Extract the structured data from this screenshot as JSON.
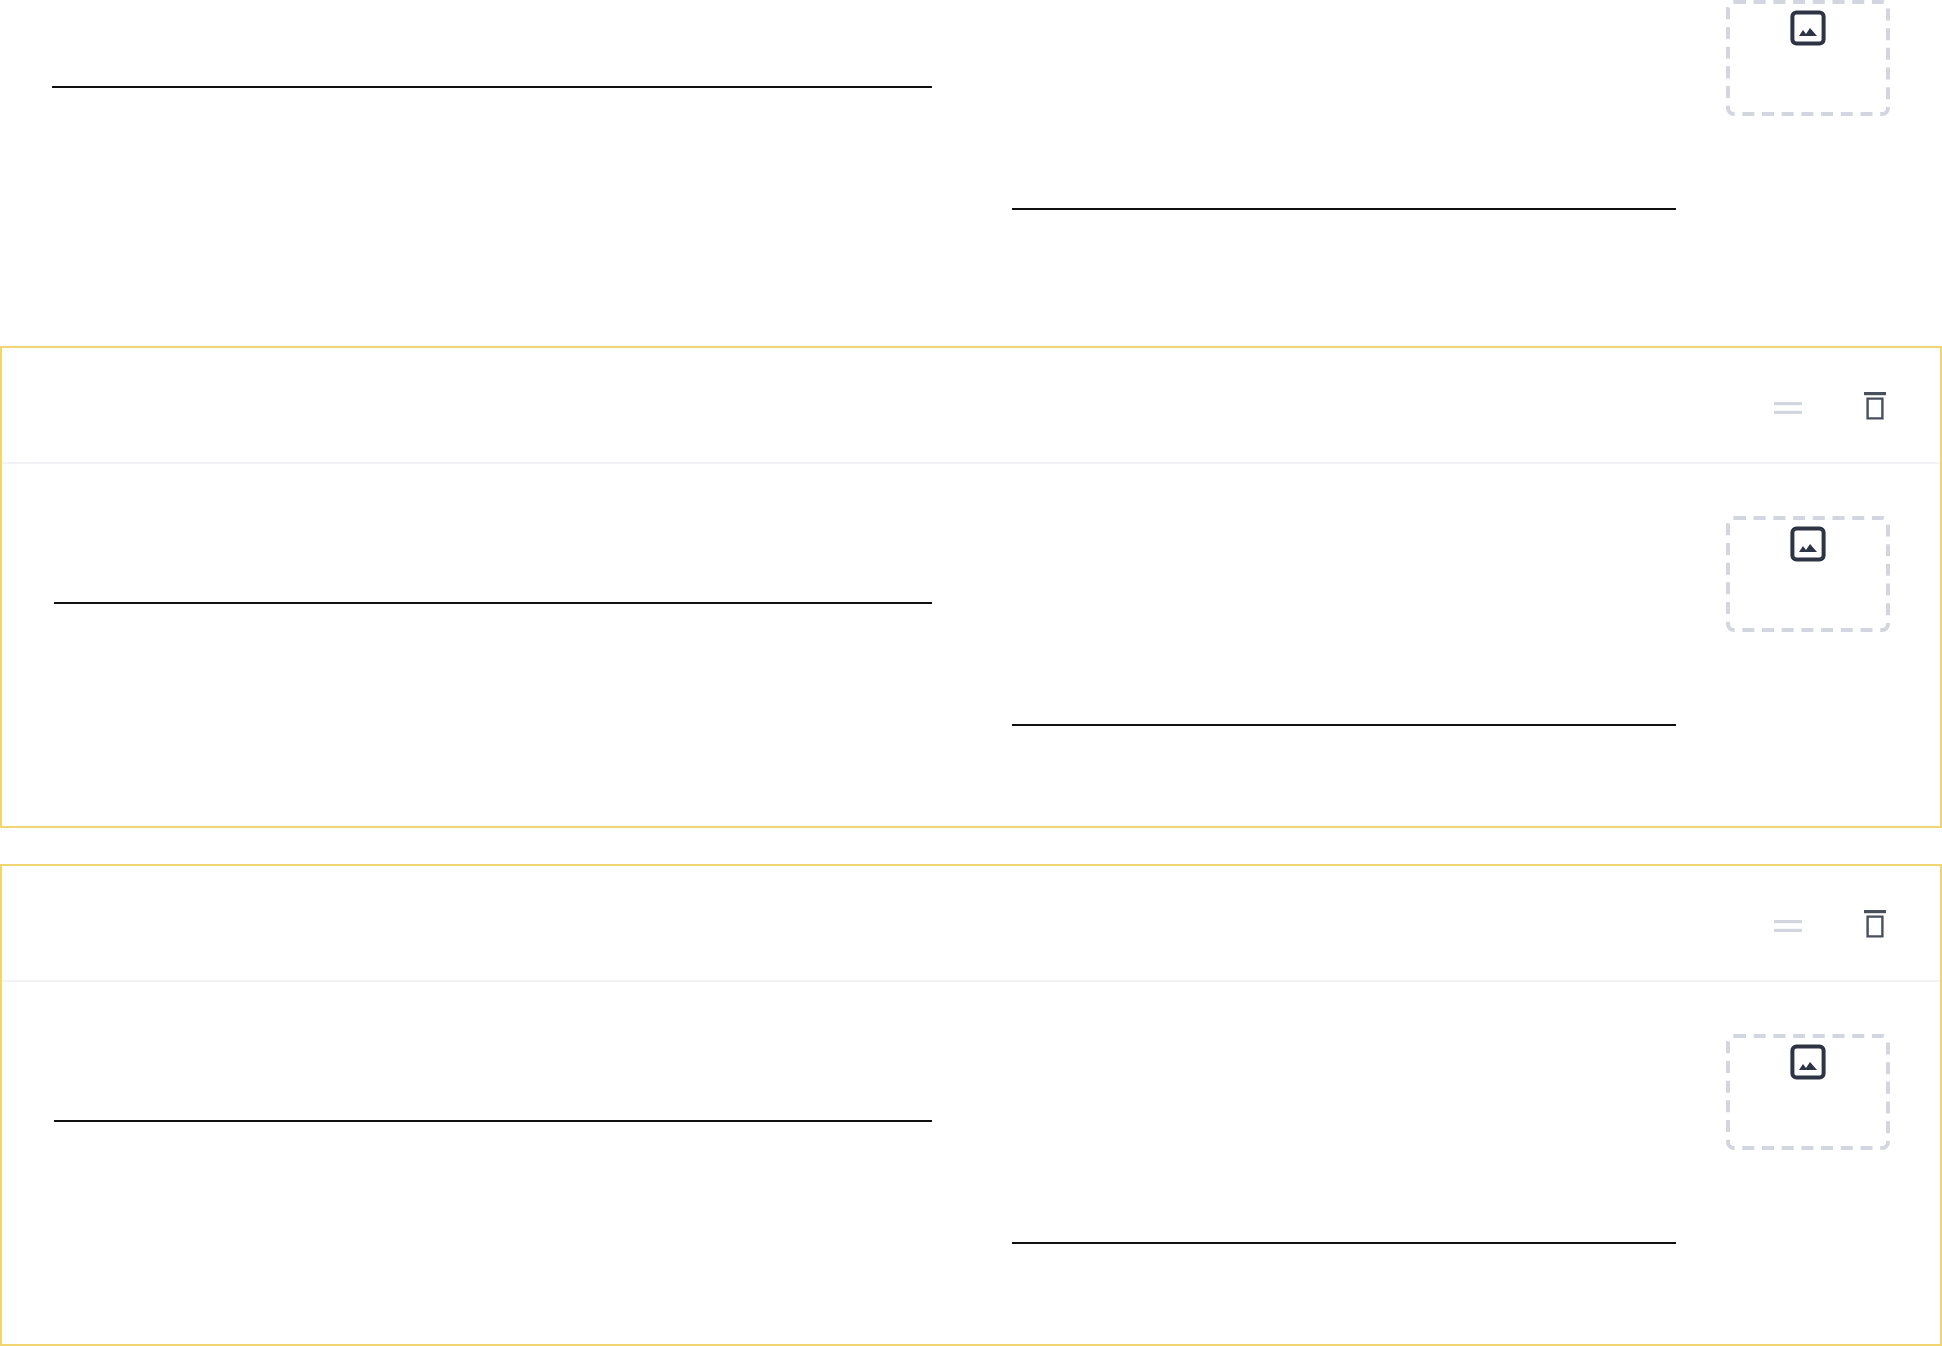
{
  "cards": [
    {
      "kind": "plain",
      "fields": [
        {
          "kind": "line"
        },
        {
          "kind": "line"
        }
      ],
      "image_slot": {
        "kind": "upload"
      }
    },
    {
      "kind": "bordered",
      "fields": [
        {
          "kind": "line"
        },
        {
          "kind": "line"
        }
      ],
      "image_slot": {
        "kind": "upload"
      }
    },
    {
      "kind": "bordered",
      "fields": [
        {
          "kind": "line"
        },
        {
          "kind": "line"
        }
      ],
      "image_slot": {
        "kind": "upload"
      }
    }
  ]
}
